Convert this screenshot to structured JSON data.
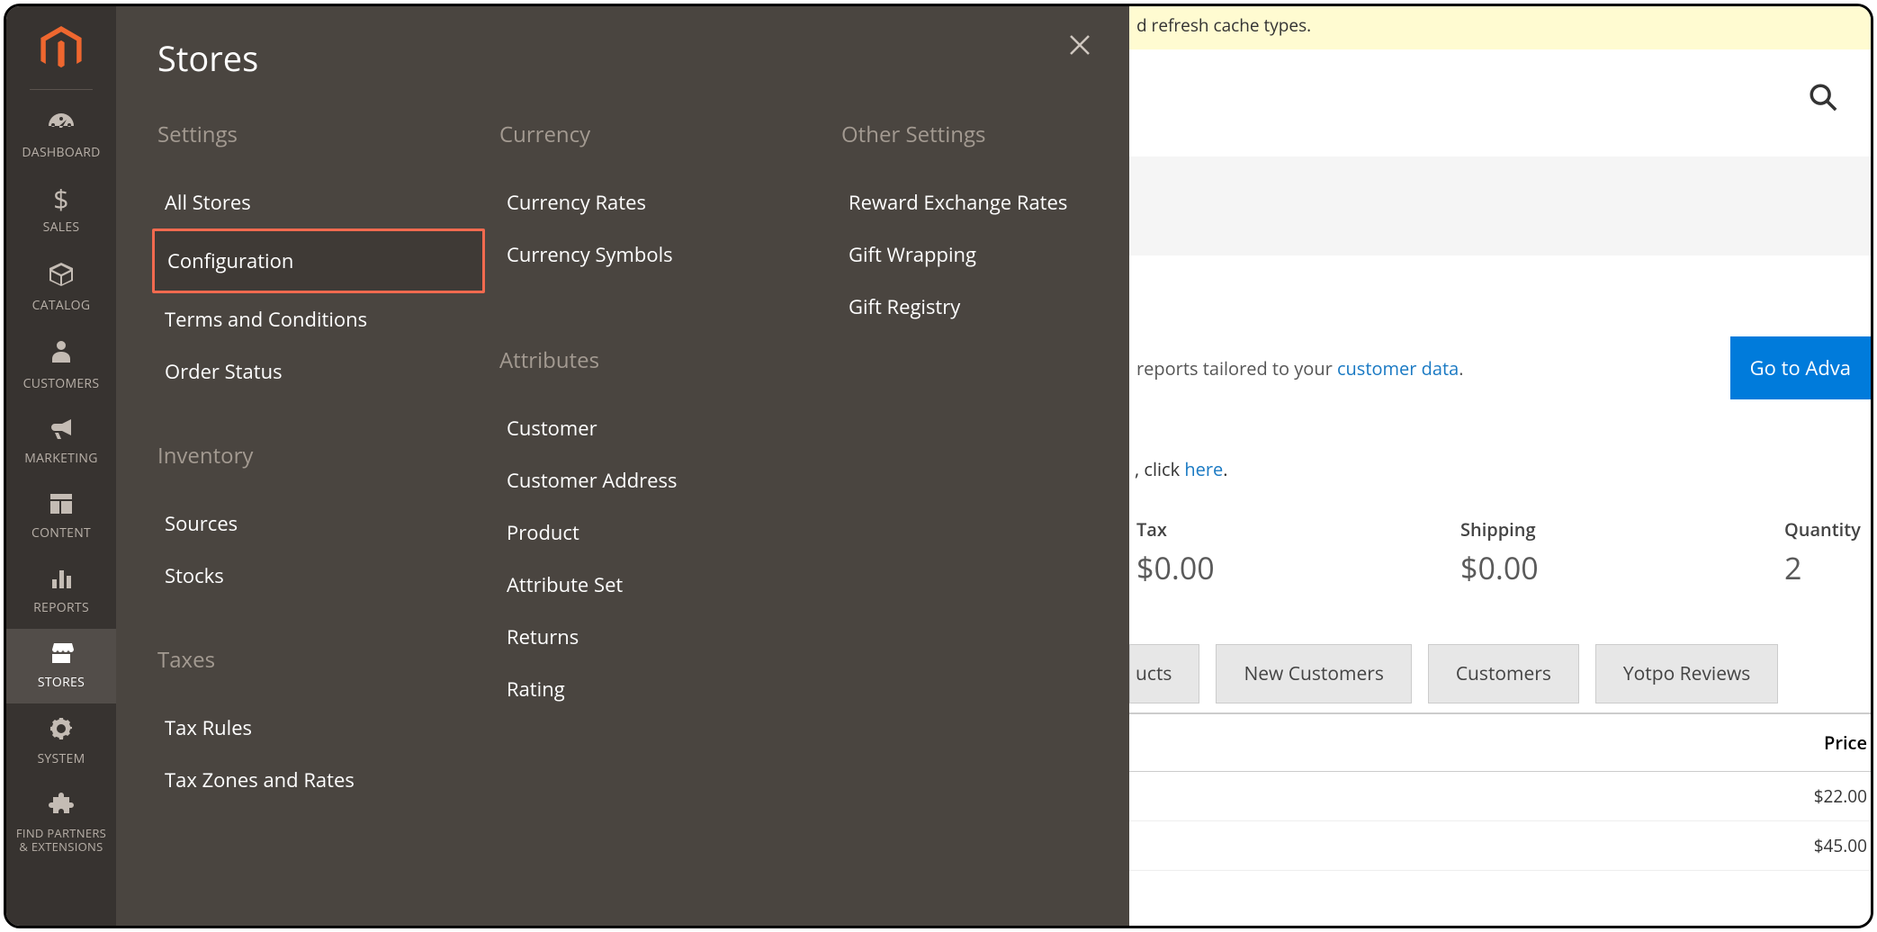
{
  "sidebar": {
    "items": [
      {
        "label": "DASHBOARD"
      },
      {
        "label": "SALES"
      },
      {
        "label": "CATALOG"
      },
      {
        "label": "CUSTOMERS"
      },
      {
        "label": "MARKETING"
      },
      {
        "label": "CONTENT"
      },
      {
        "label": "REPORTS"
      },
      {
        "label": "STORES"
      },
      {
        "label": "SYSTEM"
      },
      {
        "label": "FIND PARTNERS\n& EXTENSIONS"
      }
    ]
  },
  "flyout": {
    "title": "Stores",
    "columns": {
      "settings": {
        "heading": "Settings",
        "links": [
          "All Stores",
          "Configuration",
          "Terms and Conditions",
          "Order Status"
        ]
      },
      "inventory": {
        "heading": "Inventory",
        "links": [
          "Sources",
          "Stocks"
        ]
      },
      "taxes": {
        "heading": "Taxes",
        "links": [
          "Tax Rules",
          "Tax Zones and Rates"
        ]
      },
      "currency": {
        "heading": "Currency",
        "links": [
          "Currency Rates",
          "Currency Symbols"
        ]
      },
      "attributes": {
        "heading": "Attributes",
        "links": [
          "Customer",
          "Customer Address",
          "Product",
          "Attribute Set",
          "Returns",
          "Rating"
        ]
      },
      "other": {
        "heading": "Other Settings",
        "links": [
          "Reward Exchange Rates",
          "Gift Wrapping",
          "Gift Registry"
        ]
      }
    }
  },
  "main": {
    "notice": "d refresh cache types.",
    "cta": {
      "text": "reports tailored to your ",
      "link_text": "customer data",
      "button": "Go to Adva"
    },
    "click_here": {
      "prefix": ", click ",
      "link": "here",
      "suffix": "."
    },
    "stats": [
      {
        "label": "Tax",
        "value": "$0.00"
      },
      {
        "label": "Shipping",
        "value": "$0.00"
      },
      {
        "label": "Quantity",
        "value": "2"
      }
    ],
    "tabs": [
      "ucts",
      "New Customers",
      "Customers",
      "Yotpo Reviews"
    ],
    "table": {
      "price_header": "Price",
      "rows": [
        "$22.00",
        "$45.00"
      ]
    }
  }
}
